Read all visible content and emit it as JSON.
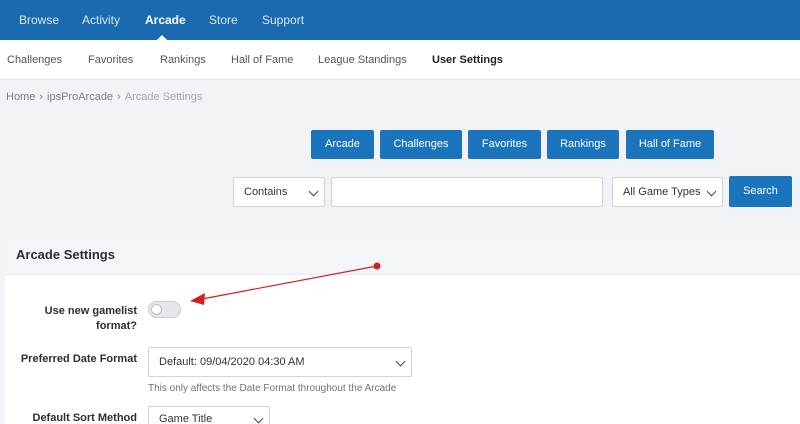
{
  "topnav": {
    "items": [
      {
        "label": "Browse"
      },
      {
        "label": "Activity"
      },
      {
        "label": "Arcade"
      },
      {
        "label": "Store"
      },
      {
        "label": "Support"
      }
    ]
  },
  "subnav": {
    "items": [
      {
        "label": "Challenges"
      },
      {
        "label": "Favorites"
      },
      {
        "label": "Rankings"
      },
      {
        "label": "Hall of Fame"
      },
      {
        "label": "League Standings"
      },
      {
        "label": "User Settings"
      }
    ]
  },
  "breadcrumb": {
    "home": "Home",
    "section": "ipsProArcade",
    "current": "Arcade Settings",
    "separator": "›"
  },
  "actions": {
    "arcade": "Arcade",
    "challenges": "Challenges",
    "favorites": "Favorites",
    "rankings": "Rankings",
    "hall_of_fame": "Hall of Fame"
  },
  "search": {
    "mode": "Contains",
    "query": "",
    "game_type": "All Game Types",
    "button": "Search"
  },
  "settings": {
    "title": "Arcade Settings",
    "gamelist_label_line1": "Use new gamelist",
    "gamelist_label_line2": "format?",
    "gamelist_enabled": false,
    "date_format_label": "Preferred Date Format",
    "date_format_value": "Default: 09/04/2020 04:30 AM",
    "date_format_hint": "This only affects the Date Format throughout the Arcade",
    "sort_method_label": "Default Sort Method",
    "sort_method_value": "Game Title"
  },
  "colors": {
    "brand": "#1a6ab0",
    "button": "#1b75bc",
    "annotation": "#d21f1f"
  }
}
